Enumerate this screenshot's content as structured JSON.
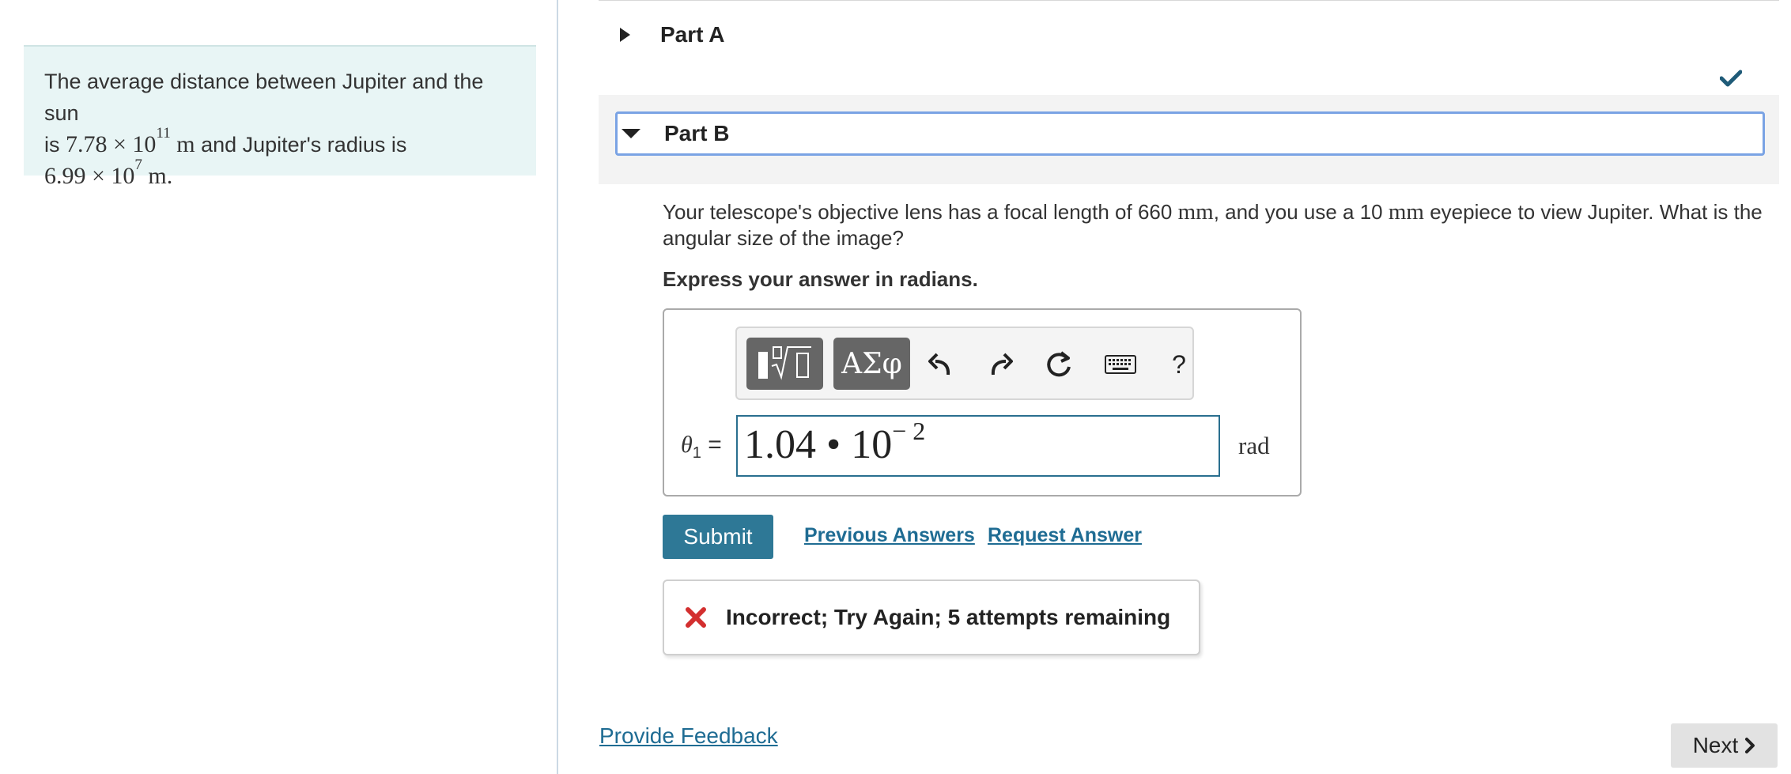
{
  "intro": {
    "line1": "The average distance between Jupiter and the sun",
    "line2_prefix": "is ",
    "dist_mantissa": "7.78",
    "times": "×",
    "base": "10",
    "dist_exponent": "11",
    "unit_m": "m",
    "line2_suffix": " and Jupiter's radius is",
    "radius_mantissa": "6.99",
    "radius_exponent": "7",
    "unit_m_period": "m."
  },
  "parts": {
    "part_a_label": "Part A",
    "part_b_label": "Part B"
  },
  "question": {
    "text1": "Your telescope's objective lens has a focal length of 660 ",
    "unit1": "mm",
    "text2": ", and you use a 10 ",
    "unit2": "mm",
    "text3": " eyepiece to view Jupiter. What is the angular size of the image?",
    "instruction": "Express your answer in radians."
  },
  "toolbar": {
    "template_button": "templates",
    "greek_button": "ΑΣφ",
    "help_label": "?",
    "icons": [
      "templates-icon",
      "greek-symbols-icon",
      "undo-icon",
      "redo-icon",
      "reset-icon",
      "keyboard-icon",
      "help-icon"
    ]
  },
  "answer": {
    "variable": "θ",
    "subscript": "1",
    "equals": "=",
    "mantissa": "1.04 • 10",
    "exponent": "− 2",
    "unit": "rad"
  },
  "actions": {
    "submit": "Submit",
    "previous_answers": "Previous Answers",
    "request_answer": "Request Answer"
  },
  "feedback": {
    "message": "Incorrect; Try Again; 5 attempts remaining"
  },
  "footer": {
    "provide_feedback": "Provide Feedback",
    "next": "Next"
  },
  "colors": {
    "accent": "#2e7896",
    "error": "#d32f2f",
    "focus_outline": "#7aa3e4",
    "intro_bg": "#e8f5f5"
  }
}
